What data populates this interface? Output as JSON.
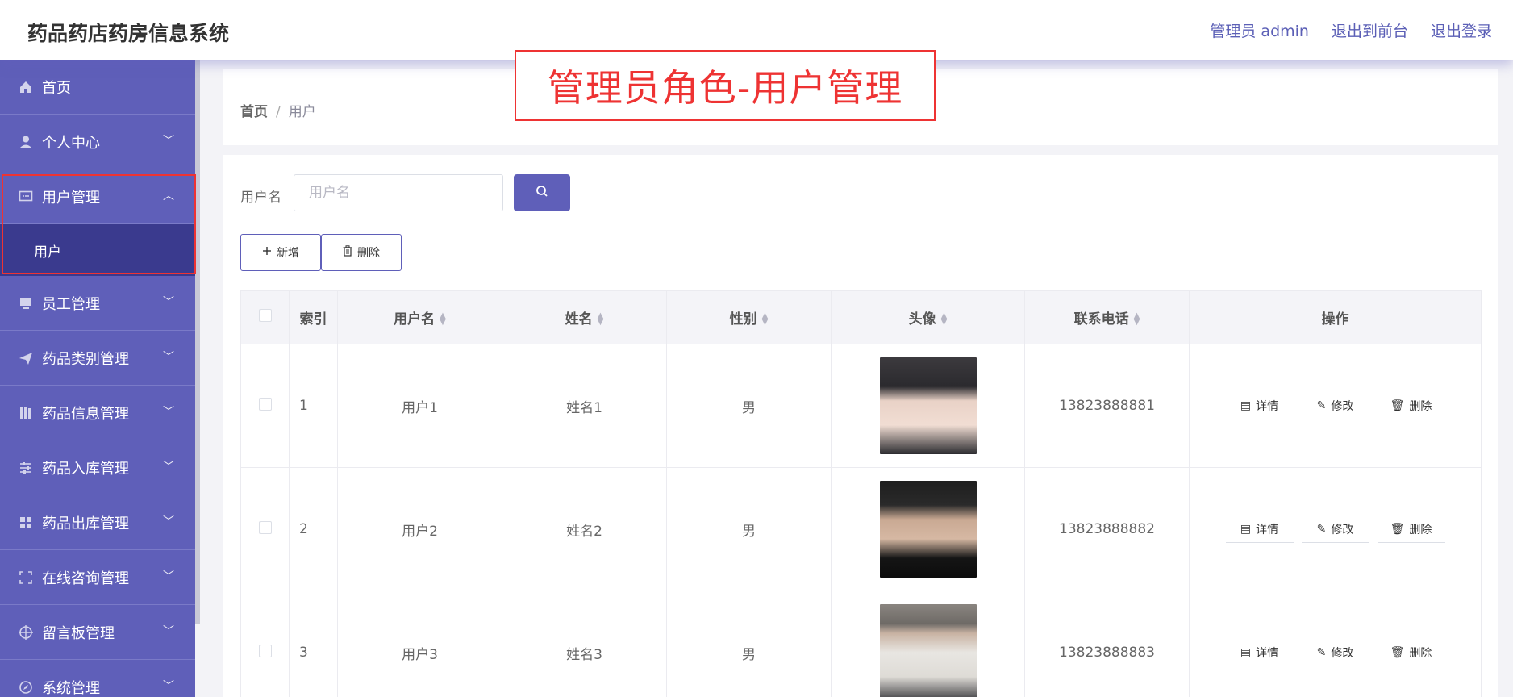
{
  "header": {
    "app_title": "药品药店药房信息系统",
    "admin_label": "管理员 admin",
    "front_link": "退出到前台",
    "logout_link": "退出登录"
  },
  "annotation": "管理员角色-用户管理",
  "sidebar": {
    "items": [
      {
        "label": "首页",
        "icon": "home-icon"
      },
      {
        "label": "个人中心",
        "icon": "user-icon"
      },
      {
        "label": "用户管理",
        "icon": "message-icon",
        "expanded": true,
        "sub": [
          "用户"
        ]
      },
      {
        "label": "员工管理",
        "icon": "monitor-icon"
      },
      {
        "label": "药品类别管理",
        "icon": "send-icon"
      },
      {
        "label": "药品信息管理",
        "icon": "book-icon"
      },
      {
        "label": "药品入库管理",
        "icon": "sliders-icon"
      },
      {
        "label": "药品出库管理",
        "icon": "grid-icon"
      },
      {
        "label": "在线咨询管理",
        "icon": "frame-icon"
      },
      {
        "label": "留言板管理",
        "icon": "target-icon"
      },
      {
        "label": "系统管理",
        "icon": "compass-icon"
      }
    ],
    "sub_item": "用户"
  },
  "breadcrumb": {
    "home": "首页",
    "sep": "/",
    "current": "用户"
  },
  "search": {
    "label": "用户名",
    "placeholder": "用户名"
  },
  "actions": {
    "add": "新增",
    "delete": "删除"
  },
  "table": {
    "headers": [
      "索引",
      "用户名",
      "姓名",
      "性别",
      "头像",
      "联系电话",
      "操作"
    ],
    "rows": [
      {
        "index": "1",
        "username": "用户1",
        "name": "姓名1",
        "gender": "男",
        "phone": "13823888881"
      },
      {
        "index": "2",
        "username": "用户2",
        "name": "姓名2",
        "gender": "男",
        "phone": "13823888882"
      },
      {
        "index": "3",
        "username": "用户3",
        "name": "姓名3",
        "gender": "男",
        "phone": "13823888883"
      }
    ],
    "row_ops": {
      "detail": "详情",
      "edit": "修改",
      "delete": "删除"
    }
  },
  "colors": {
    "accent": "#5f5fb9",
    "sidebar_active": "#3a3a8e",
    "annotation": "#ee3333"
  }
}
